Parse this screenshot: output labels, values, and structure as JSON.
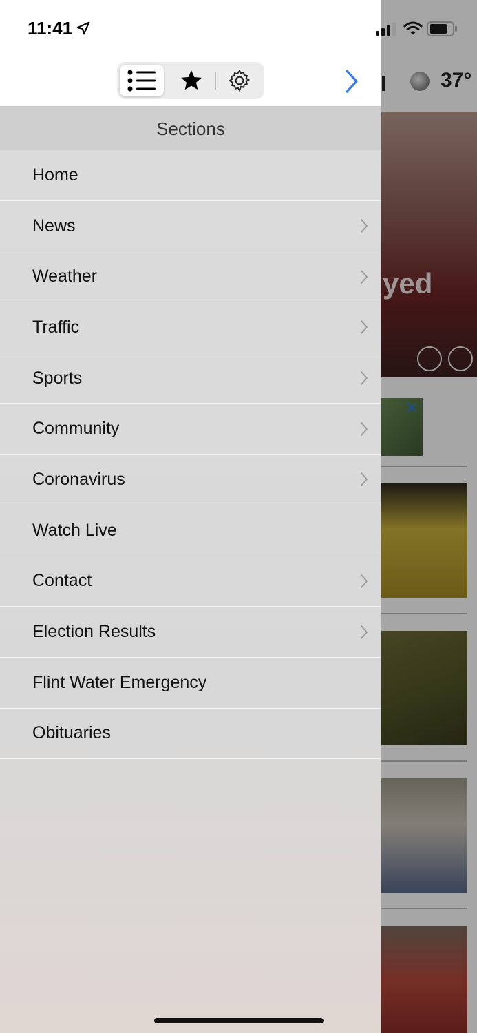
{
  "status_bar": {
    "time": "11:41"
  },
  "background": {
    "temperature": "37°",
    "hero_partial_text": "yed"
  },
  "segments": {
    "list": "list-icon",
    "favorites": "star-icon",
    "settings": "gear-icon"
  },
  "sections_header": "Sections",
  "menu": [
    {
      "label": "Home",
      "has_chevron": false
    },
    {
      "label": "News",
      "has_chevron": true
    },
    {
      "label": "Weather",
      "has_chevron": true
    },
    {
      "label": "Traffic",
      "has_chevron": true
    },
    {
      "label": "Sports",
      "has_chevron": true
    },
    {
      "label": "Community",
      "has_chevron": true
    },
    {
      "label": "Coronavirus",
      "has_chevron": true
    },
    {
      "label": "Watch Live",
      "has_chevron": false
    },
    {
      "label": "Contact",
      "has_chevron": true
    },
    {
      "label": "Election Results",
      "has_chevron": true
    },
    {
      "label": "Flint Water Emergency",
      "has_chevron": false
    },
    {
      "label": "Obituaries",
      "has_chevron": false
    }
  ],
  "colors": {
    "accent": "#2f7bf5",
    "drawer_bg": "#d9d9d9",
    "header_bg": "#cfcfcf"
  }
}
